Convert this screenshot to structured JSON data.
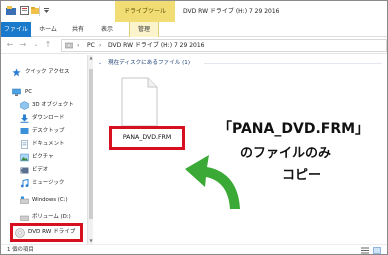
{
  "titlebar": {
    "tool_tab": "ドライブツール",
    "title": "DVD RW ドライブ (H:) 7 29 2016"
  },
  "ribbon": {
    "file": "ファイル",
    "home": "ホーム",
    "share": "共有",
    "view": "表示",
    "manage": "管理"
  },
  "address": {
    "pc": "PC",
    "drive": "DVD RW ドライブ (H:) 7 29 2016"
  },
  "nav": {
    "quick_access": "クイック アクセス",
    "pc": "PC",
    "objects3d": "3D オブジェクト",
    "downloads": "ダウンロード",
    "desktop": "デスクトップ",
    "documents": "ドキュメント",
    "pictures": "ピクチャ",
    "videos": "ビデオ",
    "music": "ミュージック",
    "windows_c": "Windows (C:)",
    "volume_d": "ボリューム (D:)",
    "dvd_drive": "DVD RW ドライブ"
  },
  "content": {
    "group_header": "現在ディスクにあるファイル (1)",
    "file_name": "PANA_DVD.FRM"
  },
  "annotation": {
    "line1": "「PANA_DVD.FRM」",
    "line2": "のファイルのみ",
    "line3": "コピー",
    "color": "#d7101f",
    "arrow_color": "#3aa935"
  },
  "status": {
    "count": "1 個の項目"
  }
}
